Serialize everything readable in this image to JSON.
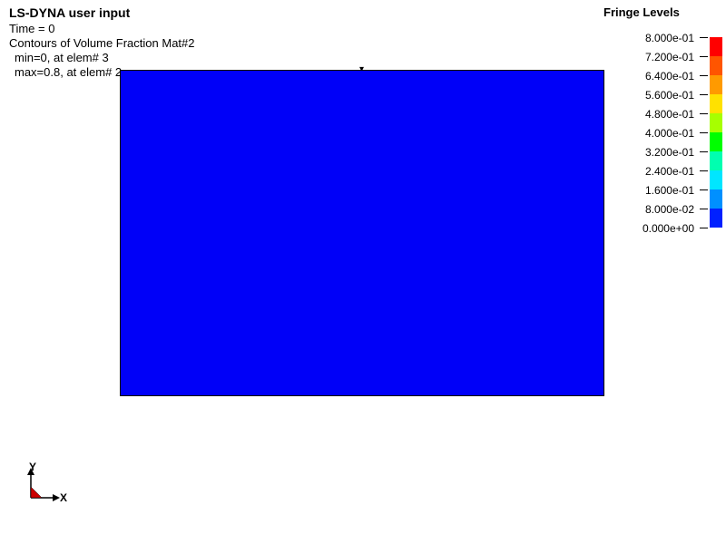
{
  "header": {
    "title": "LS-DYNA user input",
    "time_label": "Time =",
    "time_value": "            0",
    "contour_label": "Contours of Volume Fraction Mat#2",
    "min_line": "min=0, at elem# 3",
    "max_line": "max=0.8, at elem# 2"
  },
  "plot": {
    "fill_color": "#0000f8"
  },
  "legend": {
    "title": "Fringe Levels",
    "levels": [
      {
        "label": "8.000e-01",
        "color": "#ff0000"
      },
      {
        "label": "7.200e-01",
        "color": "#ff5500"
      },
      {
        "label": "6.400e-01",
        "color": "#ff9a00"
      },
      {
        "label": "5.600e-01",
        "color": "#ffe100"
      },
      {
        "label": "4.800e-01",
        "color": "#a7ff00"
      },
      {
        "label": "4.000e-01",
        "color": "#00ff00"
      },
      {
        "label": "3.200e-01",
        "color": "#00ffb0"
      },
      {
        "label": "2.400e-01",
        "color": "#00e6ff"
      },
      {
        "label": "1.600e-01",
        "color": "#0090ff"
      },
      {
        "label": "8.000e-02",
        "color": "#0020ff"
      },
      {
        "label": "0.000e+00",
        "color": "#0000f8"
      }
    ]
  },
  "triad": {
    "y_label": "Y",
    "x_label": "X"
  }
}
